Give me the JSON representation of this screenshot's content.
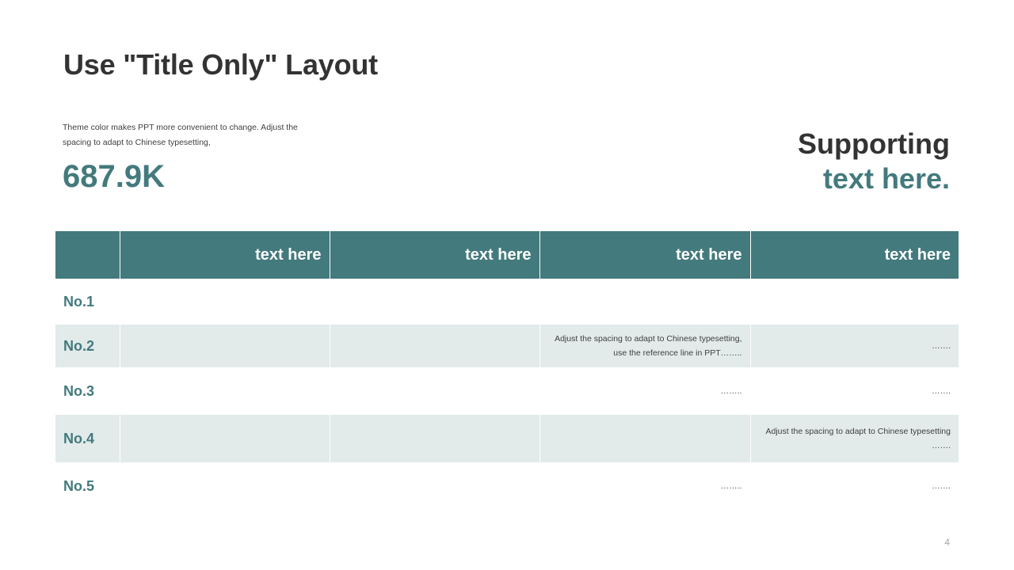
{
  "slide": {
    "title": "Use \"Title Only\" Layout",
    "description": "Theme color makes PPT more convenient  to change.  Adjust the spacing to adapt to Chinese typesetting,",
    "big_number": "687.9K",
    "supporting_line1": "Supporting",
    "supporting_line2": "text here.",
    "page_number": "4",
    "accent_color": "#437a7d",
    "shade_color": "#e2eaea"
  },
  "table": {
    "headers": [
      "",
      "text here",
      "text here",
      "text here",
      "text here"
    ],
    "rows": [
      {
        "label": "No.1",
        "cells": [
          "",
          "",
          "",
          ""
        ]
      },
      {
        "label": "No.2",
        "cells": [
          "",
          "",
          "Adjust the spacing to adapt to Chinese typesetting, use the reference line in PPT……..",
          "……."
        ]
      },
      {
        "label": "No.3",
        "cells": [
          "",
          "",
          "……..",
          "……."
        ]
      },
      {
        "label": "No.4",
        "cells": [
          "",
          "",
          "",
          "Adjust the spacing to adapt to Chinese typesetting ……."
        ]
      },
      {
        "label": "No.5",
        "cells": [
          "",
          "",
          "……..",
          "……."
        ]
      }
    ]
  }
}
